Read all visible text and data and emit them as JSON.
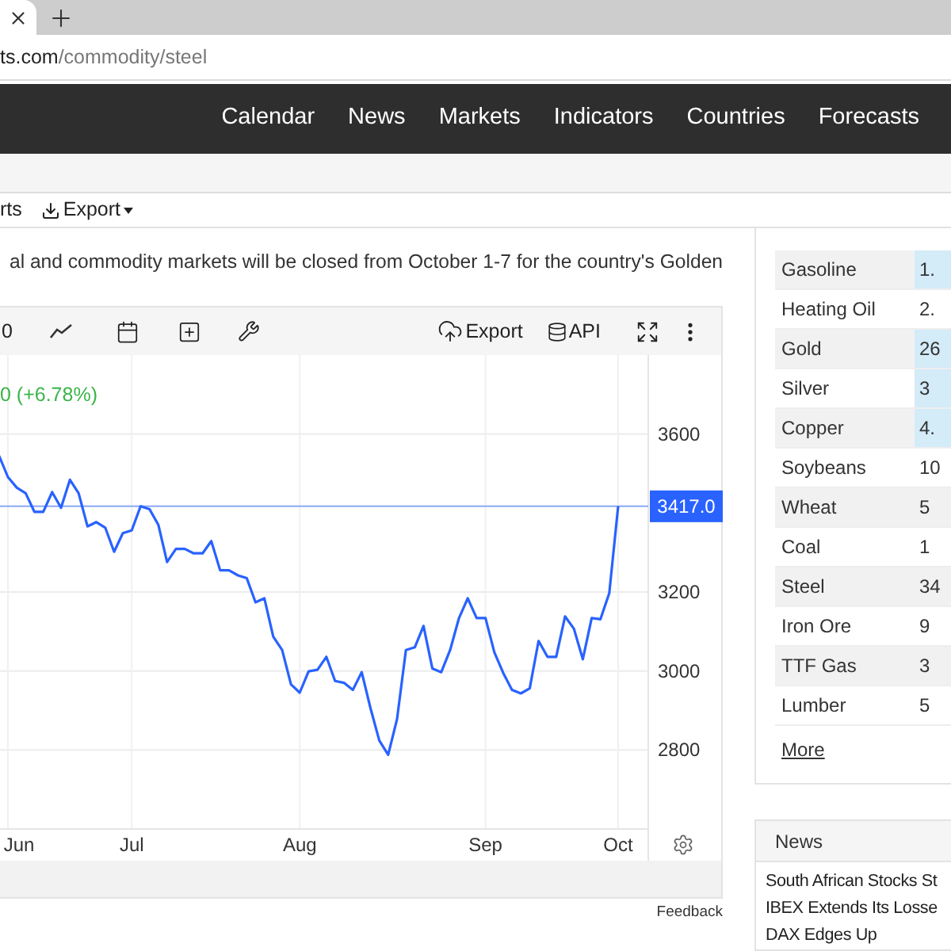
{
  "browser": {
    "url_domain": "ts.com",
    "url_path": "/commodity/steel"
  },
  "nav": [
    "Calendar",
    "News",
    "Markets",
    "Indicators",
    "Countries",
    "Forecasts"
  ],
  "toolbar": [
    {
      "kind": "link",
      "label": "rts"
    },
    {
      "kind": "dropdown",
      "label": "Export"
    }
  ],
  "paragraph": "al and commodity markets will be closed from October 1-7 for the country's Golden",
  "chart_toolbar": {
    "range_label": "0",
    "export": "Export",
    "api": "API"
  },
  "change": "0 (+6.78%)",
  "chart_data": {
    "type": "line",
    "categories": [
      null,
      "Jun",
      null,
      null,
      null,
      null,
      null,
      null,
      null,
      null,
      null,
      null,
      null,
      null,
      null,
      "Jul",
      null,
      null,
      null,
      null,
      null,
      null,
      null,
      null,
      null,
      null,
      null,
      null,
      null,
      null,
      null,
      null,
      null,
      null,
      "Aug",
      null,
      null,
      null,
      null,
      null,
      null,
      null,
      null,
      null,
      null,
      null,
      null,
      null,
      null,
      null,
      null,
      null,
      null,
      null,
      null,
      "Sep",
      null,
      null,
      null,
      null,
      null,
      null,
      null,
      null,
      null,
      null,
      null,
      null,
      null,
      null,
      "Oct"
    ],
    "series": [
      {
        "color": "#2962ff",
        "values": [
          3545,
          3491,
          3464,
          3450,
          3403,
          3403,
          3453,
          3413,
          3484,
          3450,
          3366,
          3377,
          3363,
          3302,
          3349,
          3356,
          3417,
          3410,
          3370,
          3276,
          3309,
          3309,
          3298,
          3298,
          3329,
          3255,
          3255,
          3242,
          3235,
          3174,
          3184,
          3087,
          3053,
          2966,
          2945,
          2999,
          3003,
          3036,
          2975,
          2970,
          2952,
          2997,
          2905,
          2824,
          2788,
          2878,
          3053,
          3060,
          3114,
          3006,
          2997,
          3053,
          3134,
          3184,
          3134,
          3134,
          3047,
          2995,
          2952,
          2943,
          2956,
          3076,
          3036,
          3036,
          3138,
          3107,
          3030,
          3134,
          3131,
          3197,
          3417
        ]
      }
    ],
    "ylim": [
      2600,
      3800
    ],
    "yticks": [
      2800,
      3000,
      3200,
      3600
    ],
    "grid": true,
    "ref_lines": [
      {
        "axis": "y",
        "value": 3417,
        "label": "3417.0",
        "color": "#8aa8f8"
      }
    ]
  },
  "feedback": "Feedback",
  "commodities": [
    {
      "name": "Gasoline",
      "value": "1.",
      "highlighted": true
    },
    {
      "name": "Heating Oil",
      "value": "2.",
      "highlighted": false
    },
    {
      "name": "Gold",
      "value": "26",
      "highlighted": true
    },
    {
      "name": "Silver",
      "value": "3",
      "highlighted": true
    },
    {
      "name": "Copper",
      "value": "4.",
      "highlighted": true
    },
    {
      "name": "Soybeans",
      "value": "10",
      "highlighted": false
    },
    {
      "name": "Wheat",
      "value": "5",
      "highlighted": false
    },
    {
      "name": "Coal",
      "value": "1",
      "highlighted": false
    },
    {
      "name": "Steel",
      "value": "34",
      "highlighted": false
    },
    {
      "name": "Iron Ore",
      "value": "9",
      "highlighted": false
    },
    {
      "name": "TTF Gas",
      "value": "3",
      "highlighted": false
    },
    {
      "name": "Lumber",
      "value": "5",
      "highlighted": false
    }
  ],
  "more": "More",
  "news": {
    "title": "News",
    "items": [
      "South African Stocks St",
      "IBEX Extends Its Losse",
      "DAX Edges Up"
    ]
  }
}
